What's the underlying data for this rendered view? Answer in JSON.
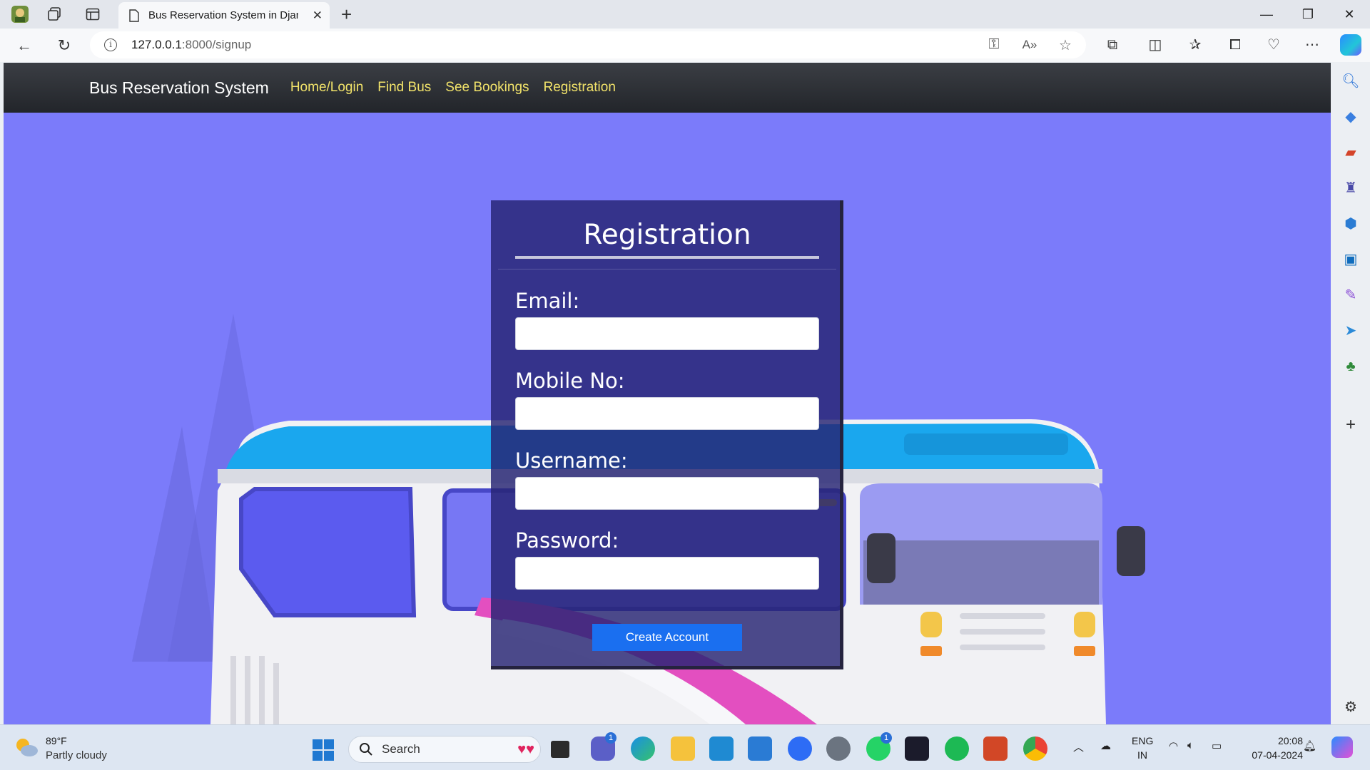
{
  "browser": {
    "tab_title": "Bus Reservation System in Djang",
    "url_host": "127.0.0.1",
    "url_rest": ":8000/signup"
  },
  "site": {
    "brand": "Bus Reservation System",
    "nav": [
      "Home/Login",
      "Find Bus",
      "See Bookings",
      "Registration"
    ]
  },
  "form": {
    "title": "Registration",
    "email_label": "Email:",
    "mobile_label": "Mobile No:",
    "username_label": "Username:",
    "password_label": "Password:",
    "email_value": "",
    "mobile_value": "",
    "username_value": "",
    "password_value": "",
    "submit_label": "Create Account"
  },
  "taskbar": {
    "weather_temp": "89°F",
    "weather_desc": "Partly cloudy",
    "search_label": "Search",
    "lang_top": "ENG",
    "lang_bottom": "IN",
    "time": "20:08",
    "date": "07-04-2024",
    "chat_badge": "1",
    "whatsapp_badge": "1"
  },
  "colors": {
    "page_bg": "#7b7bfa",
    "nav_link": "#f2e36a",
    "button": "#1a6ff0",
    "card": "#26237380"
  }
}
